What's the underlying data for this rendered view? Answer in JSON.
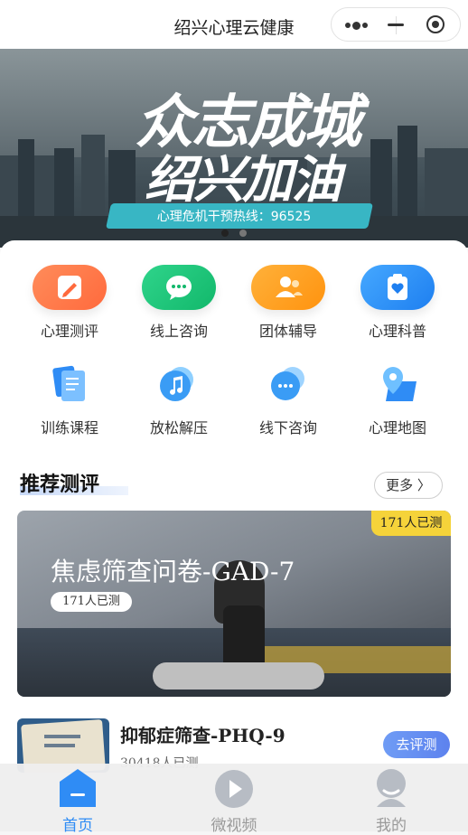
{
  "header": {
    "title": "绍兴心理云健康"
  },
  "banner": {
    "headline_line1": "众志成城",
    "headline_line2": "绍兴加油",
    "hotline": "心理危机干预热线：96525"
  },
  "menu": {
    "row1": [
      {
        "label": "心理测评",
        "color": "#ff7a45"
      },
      {
        "label": "线上咨询",
        "color": "#19c37a"
      },
      {
        "label": "团体辅导",
        "color": "#ff9f1a"
      },
      {
        "label": "心理科普",
        "color": "#2f8cf5"
      }
    ],
    "row2": [
      {
        "label": "训练课程"
      },
      {
        "label": "放松解压"
      },
      {
        "label": "线下咨询"
      },
      {
        "label": "心理地图"
      }
    ]
  },
  "recommend": {
    "title": "推荐测评",
    "more_label": "更多 〉",
    "featured": {
      "badge": "171人已测",
      "title": "焦虑筛查问卷-GAD-7",
      "tag": "171人已测"
    },
    "items": [
      {
        "title": "抑郁症筛查-PHQ-9",
        "count": "30418人已测",
        "button": "去评测"
      }
    ]
  },
  "tabbar": {
    "tabs": [
      {
        "label": "首页",
        "active": true,
        "color": "#2f8cf5"
      },
      {
        "label": "微视频",
        "active": false,
        "color": "#9a9a9a"
      },
      {
        "label": "我的",
        "active": false,
        "color": "#9a9a9a"
      }
    ]
  }
}
